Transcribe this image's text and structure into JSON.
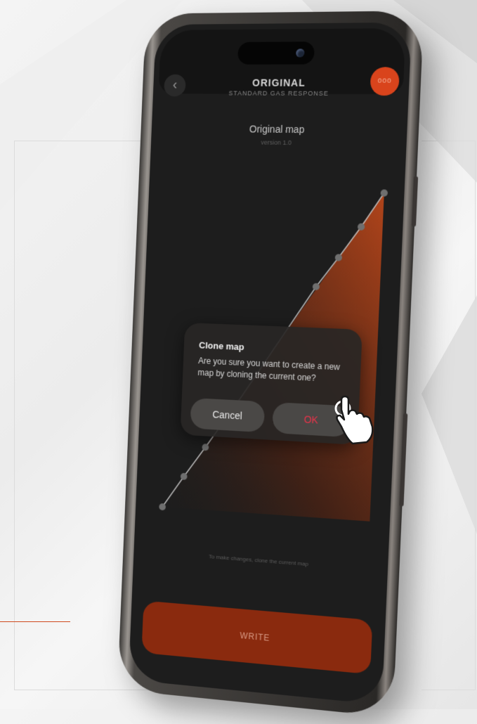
{
  "header": {
    "title": "ORIGINAL",
    "subtitle": "STANDARD GAS RESPONSE",
    "back_icon": "chevron-left-icon",
    "more_icon": "more-dots-icon",
    "more_label": "ooo"
  },
  "map": {
    "title": "Original map",
    "version": "version 1.0",
    "hint": "To make changes, clone the current map",
    "accent_color": "#d9441c"
  },
  "dialog": {
    "title": "Clone map",
    "message": "Are you sure you want to create a new map by cloning the current one?",
    "cancel_label": "Cancel",
    "ok_label": "OK"
  },
  "footer": {
    "write_label": "WRITE"
  },
  "colors": {
    "accent": "#d9441c",
    "write_button": "#8a2a0e",
    "ok_text": "#e8334a",
    "screen_bg": "#1d1d1d"
  }
}
